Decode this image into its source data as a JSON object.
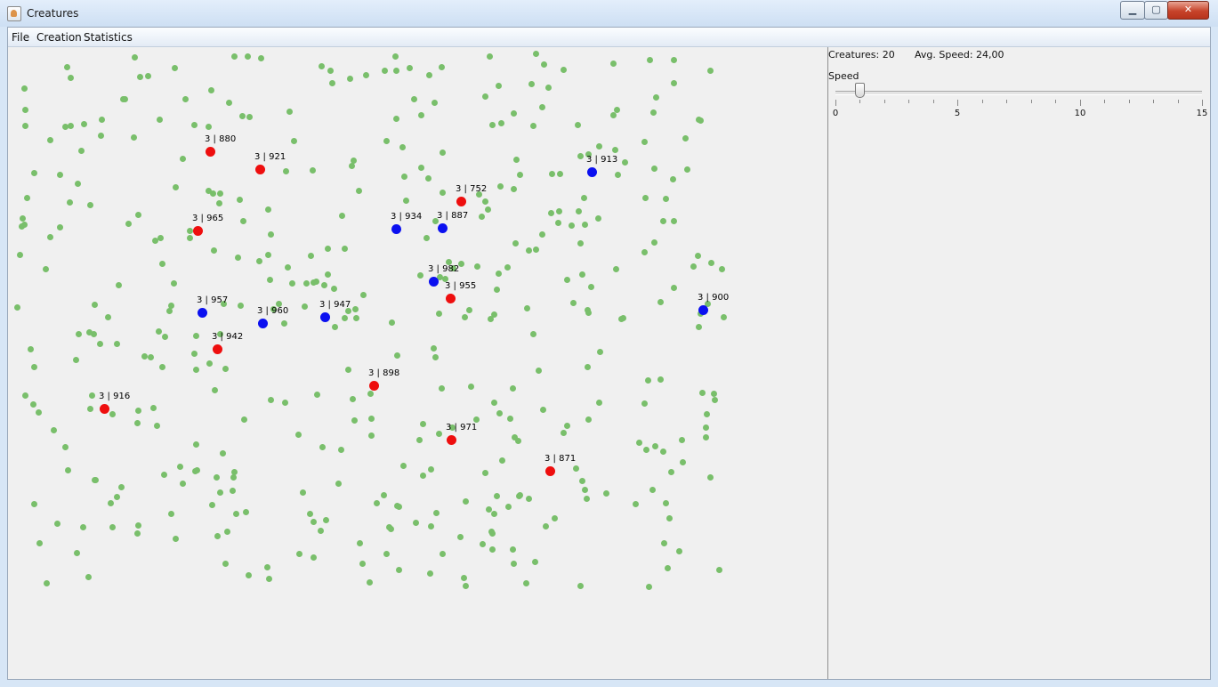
{
  "window": {
    "title": "Creatures",
    "icon": "java-cup-icon",
    "controls": [
      "minimize",
      "maximize",
      "close"
    ]
  },
  "menu": {
    "items": [
      "File",
      "Creation",
      "Statistics"
    ]
  },
  "stats": {
    "creatures": "Creatures: 20",
    "avg_speed": "Avg. Speed: 24,00"
  },
  "speed": {
    "label": "Speed",
    "min": 0,
    "max": 15,
    "value": 1,
    "tick_labels": [
      "0",
      "5",
      "10",
      "15"
    ]
  },
  "colors": {
    "food": "#79bf6b",
    "red_creature": "#ee0e0e",
    "blue_creature": "#0b10f0"
  },
  "creatures": [
    {
      "color": "red",
      "label": "3 | 880"
    },
    {
      "color": "red",
      "label": "3 | 921"
    },
    {
      "color": "red",
      "label": "3 | 965"
    },
    {
      "color": "red",
      "label": "3 | 752"
    },
    {
      "color": "red",
      "label": "3 | 955"
    },
    {
      "color": "red",
      "label": "3 | 942"
    },
    {
      "color": "red",
      "label": "3 | 916"
    },
    {
      "color": "red",
      "label": "3 | 898"
    },
    {
      "color": "red",
      "label": "3 | 971"
    },
    {
      "color": "red",
      "label": "3 | 871"
    },
    {
      "color": "blue",
      "label": "3 | 913"
    },
    {
      "color": "blue",
      "label": "3 | 934"
    },
    {
      "color": "blue",
      "label": "3 | 887"
    },
    {
      "color": "blue",
      "label": "3 | 982"
    },
    {
      "color": "blue",
      "label": "3 | 957"
    },
    {
      "color": "blue",
      "label": "3 | 960"
    },
    {
      "color": "blue",
      "label": "3 | 947"
    },
    {
      "color": "blue",
      "label": "3 | 900"
    }
  ]
}
